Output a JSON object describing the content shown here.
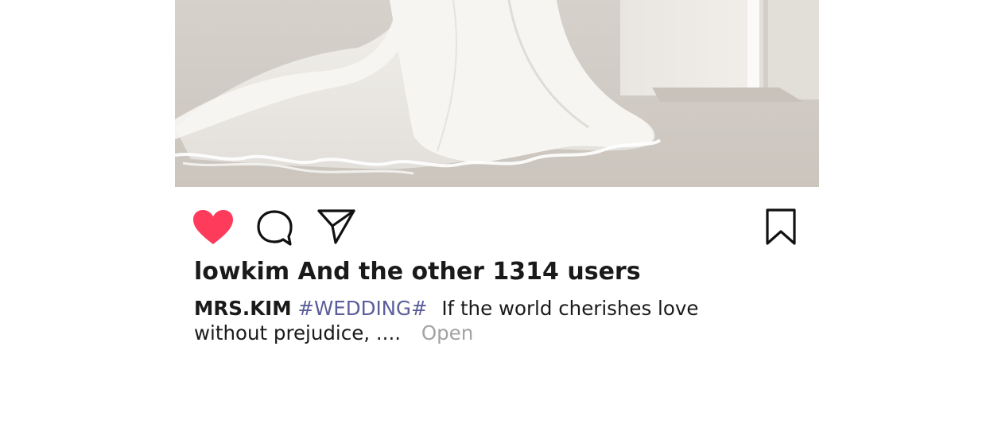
{
  "post": {
    "image_alt": "white wedding dress train on floor",
    "likes_text": "lowkim And the other 1314 users",
    "caption": {
      "username": "MRS.KIM",
      "hashtag": "#WEDDING#",
      "text": "If the world cherishes love without prejudice, ....",
      "open_label": "Open"
    }
  },
  "icons": {
    "like": "heart-icon",
    "comment": "comment-bubble-icon",
    "share": "paper-plane-icon",
    "save": "bookmark-icon"
  },
  "colors": {
    "like_active": "#ff3b5c",
    "hashtag": "#5b5e99",
    "open_link": "#a3a3a3",
    "text": "#1a1a1a"
  }
}
